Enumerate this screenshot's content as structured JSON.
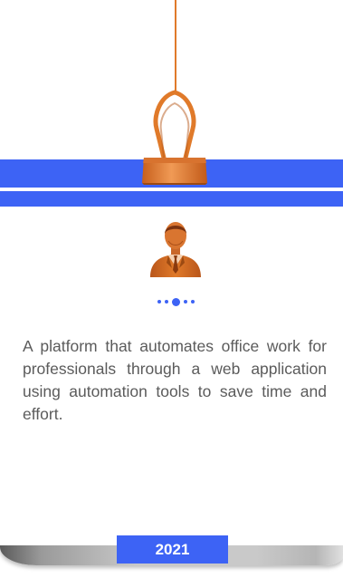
{
  "card": {
    "description": "A platform that automates office work for professionals through a web application using automation tools to save time and effort.",
    "year": "2021"
  },
  "pagination": {
    "total": 5,
    "active_index": 2
  },
  "icons": {
    "clip": "binder-clip-icon",
    "avatar": "businessman-icon"
  },
  "colors": {
    "accent": "#3d63f5",
    "clip": "#e07a2a",
    "text": "#5b5b5b"
  }
}
